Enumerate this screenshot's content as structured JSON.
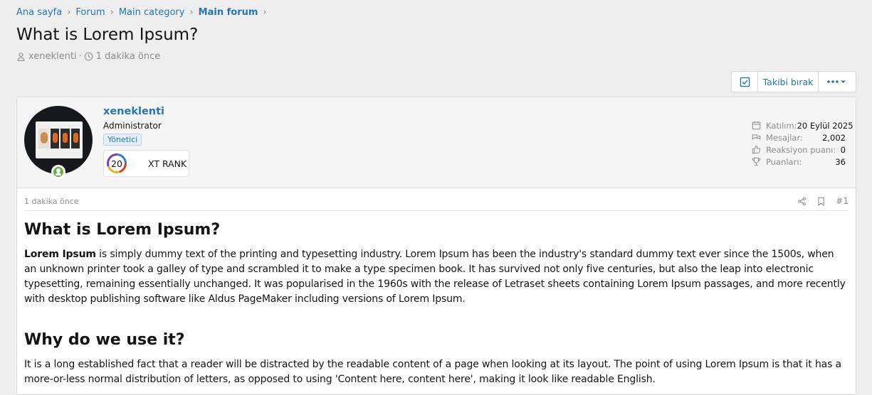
{
  "breadcrumb": [
    "Ana sayfa",
    "Forum",
    "Main category",
    "Main forum"
  ],
  "thread": {
    "title": "What is Lorem Ipsum?",
    "author": "xeneklenti",
    "time": "1 dakika önce"
  },
  "actions": {
    "unwatch_label": "Takibi bırak"
  },
  "user": {
    "name": "xeneklenti",
    "title": "Administrator",
    "banner": "Yönetici",
    "rank_number": "20",
    "rank_label": "XT RANK",
    "stats": [
      {
        "label": "Katılım:",
        "value": "20 Eylül 2025",
        "icon": "calendar-icon"
      },
      {
        "label": "Mesajlar:",
        "value": "2,002",
        "icon": "messages-icon"
      },
      {
        "label": "Reaksiyon puanı:",
        "value": "0",
        "icon": "thumbs-up-icon"
      },
      {
        "label": "Puanları:",
        "value": "36",
        "icon": "trophy-icon"
      }
    ]
  },
  "post": {
    "time": "1 dakika önce",
    "number": "#1",
    "heading1": "What is Lorem Ipsum?",
    "p1_bold": "Lorem Ipsum",
    "p1_rest": " is simply dummy text of the printing and typesetting industry. Lorem Ipsum has been the industry's standard dummy text ever since the 1500s, when an unknown printer took a galley of type and scrambled it to make a type specimen book. It has survived not only five centuries, but also the leap into electronic typesetting, remaining essentially unchanged. It was popularised in the 1960s with the release of Letraset sheets containing Lorem Ipsum passages, and more recently with desktop publishing software like Aldus PageMaker including versions of Lorem Ipsum.",
    "heading2": "Why do we use it?",
    "p2": "It is a long established fact that a reader will be distracted by the readable content of a page when looking at its layout. The point of using Lorem Ipsum is that it has a more-or-less normal distribution of letters, as opposed to using 'Content here, content here', making it look like readable English."
  },
  "colors": {
    "link": "#2577b1",
    "online": "#63b041",
    "background": "#eeeeee"
  }
}
